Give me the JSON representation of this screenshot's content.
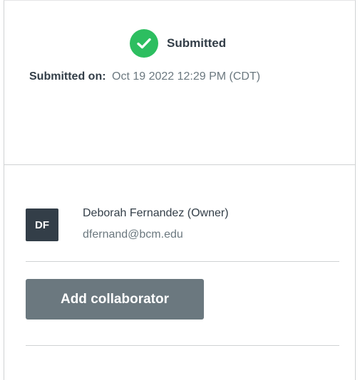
{
  "status": {
    "label": "Submitted",
    "icon": "check-circle-icon",
    "color": "#2dbe60"
  },
  "submission": {
    "label": "Submitted on:",
    "value": "Oct 19 2022 12:29 PM (CDT)"
  },
  "owner": {
    "initials": "DF",
    "name": "Deborah Fernandez (Owner)",
    "email": "dfernand@bcm.edu",
    "avatar_color": "#333e48"
  },
  "actions": {
    "add_collaborator_label": "Add collaborator",
    "button_color": "#6b787f"
  }
}
